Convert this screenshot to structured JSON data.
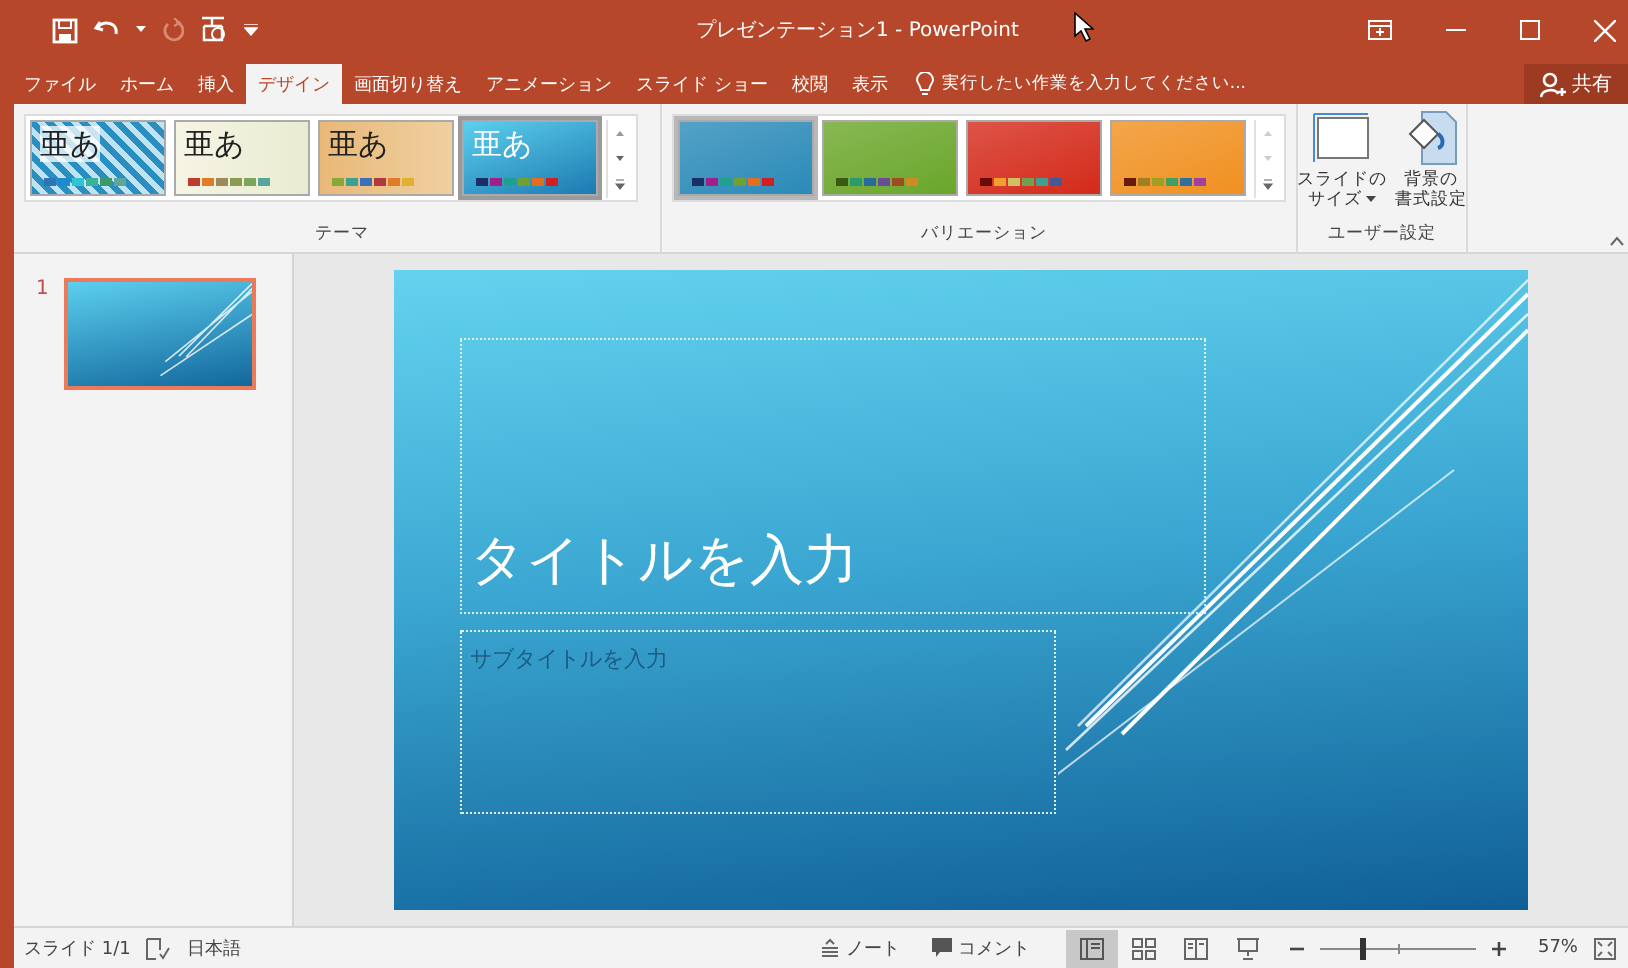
{
  "window": {
    "title": "プレゼンテーション1 - PowerPoint"
  },
  "tabs": [
    {
      "label": "ファイル",
      "selected": false
    },
    {
      "label": "ホーム",
      "selected": false
    },
    {
      "label": "挿入",
      "selected": false
    },
    {
      "label": "デザイン",
      "selected": true
    },
    {
      "label": "画面切り替え",
      "selected": false
    },
    {
      "label": "アニメーション",
      "selected": false
    },
    {
      "label": "スライド ショー",
      "selected": false
    },
    {
      "label": "校閲",
      "selected": false
    },
    {
      "label": "表示",
      "selected": false
    }
  ],
  "tell_me": {
    "placeholder": "実行したい作業を入力してください..."
  },
  "share": "共有",
  "themes": {
    "label": "テーマ",
    "items": [
      {
        "kind": "pattern",
        "sample": "亜あ",
        "selected": false,
        "swatches": [
          {
            "color": "#2e75b6"
          },
          {
            "color": "#1e88d0"
          },
          {
            "color": "#2ec4d4"
          },
          {
            "color": "#3bb39c"
          },
          {
            "color": "#3a9a6a"
          },
          {
            "color": "#5fa59a"
          }
        ]
      },
      {
        "kind": "cream",
        "sample": "亜あ",
        "selected": false,
        "swatches": [
          {
            "color": "#c0392b"
          },
          {
            "color": "#e07b2a"
          },
          {
            "color": "#9c8a5a"
          },
          {
            "color": "#8a9a50"
          },
          {
            "color": "#7aa55a"
          },
          {
            "color": "#5aa59a"
          }
        ]
      },
      {
        "kind": "wood",
        "sample": "亜あ",
        "selected": false,
        "swatches": [
          {
            "color": "#8aa838"
          },
          {
            "color": "#3aa390"
          },
          {
            "color": "#3d6fb8"
          },
          {
            "color": "#b03a3a"
          },
          {
            "color": "#e07b2a"
          },
          {
            "color": "#e0b030"
          }
        ]
      },
      {
        "kind": "gradient",
        "sample": "亜あ",
        "selected": true,
        "swatches": [
          {
            "color": "#1a2f66"
          },
          {
            "color": "#a0208a"
          },
          {
            "color": "#20a090"
          },
          {
            "color": "#70a030"
          },
          {
            "color": "#e07020"
          },
          {
            "color": "#d02020"
          }
        ]
      }
    ]
  },
  "variations": {
    "label": "バリエーション",
    "items": [
      {
        "color": "#2a8ab8",
        "selected": true,
        "swatches": [
          {
            "color": "#1a2f66"
          },
          {
            "color": "#a0208a"
          },
          {
            "color": "#20a090"
          },
          {
            "color": "#70a030"
          },
          {
            "color": "#e07020"
          },
          {
            "color": "#d02020"
          }
        ]
      },
      {
        "color": "#6aa62a",
        "selected": false,
        "swatches": [
          {
            "color": "#3a5a10"
          },
          {
            "color": "#2a9a70"
          },
          {
            "color": "#2a6a9a"
          },
          {
            "color": "#6a4a9a"
          },
          {
            "color": "#a04a20"
          },
          {
            "color": "#d08a20"
          }
        ]
      },
      {
        "color": "#d42a1a",
        "selected": false,
        "swatches": [
          {
            "color": "#6a0a0a"
          },
          {
            "color": "#f0a030"
          },
          {
            "color": "#d0c060"
          },
          {
            "color": "#70a050"
          },
          {
            "color": "#40a090"
          },
          {
            "color": "#405a9a"
          }
        ]
      },
      {
        "color": "#f09020",
        "selected": false,
        "swatches": [
          {
            "color": "#6a1a0a"
          },
          {
            "color": "#a08020"
          },
          {
            "color": "#a0a020"
          },
          {
            "color": "#40a060"
          },
          {
            "color": "#3070a0"
          },
          {
            "color": "#a040a0"
          }
        ]
      }
    ]
  },
  "customize": {
    "label": "ユーザー設定",
    "buttons": [
      {
        "kind": "slide-size",
        "lines": [
          "スライドの",
          "サイズ"
        ],
        "dropdown": true
      },
      {
        "kind": "background",
        "lines": [
          "背景の",
          "書式設定"
        ],
        "dropdown": false
      }
    ]
  },
  "slides_panel": {
    "thumbnails": [
      {
        "number": "1",
        "selected": true
      }
    ]
  },
  "slide": {
    "title_placeholder": "タイトルを入力",
    "subtitle_placeholder": "サブタイトルを入力"
  },
  "status_bar": {
    "slide_info": "スライド 1/1",
    "language": "日本語",
    "notes": "ノート",
    "comments": "コメント",
    "views": [
      {
        "kind": "normal",
        "selected": true
      },
      {
        "kind": "sorter",
        "selected": false
      },
      {
        "kind": "reading",
        "selected": false
      },
      {
        "kind": "slideshow",
        "selected": false
      }
    ],
    "zoom": {
      "level": 0.27,
      "reading": "57%"
    }
  }
}
